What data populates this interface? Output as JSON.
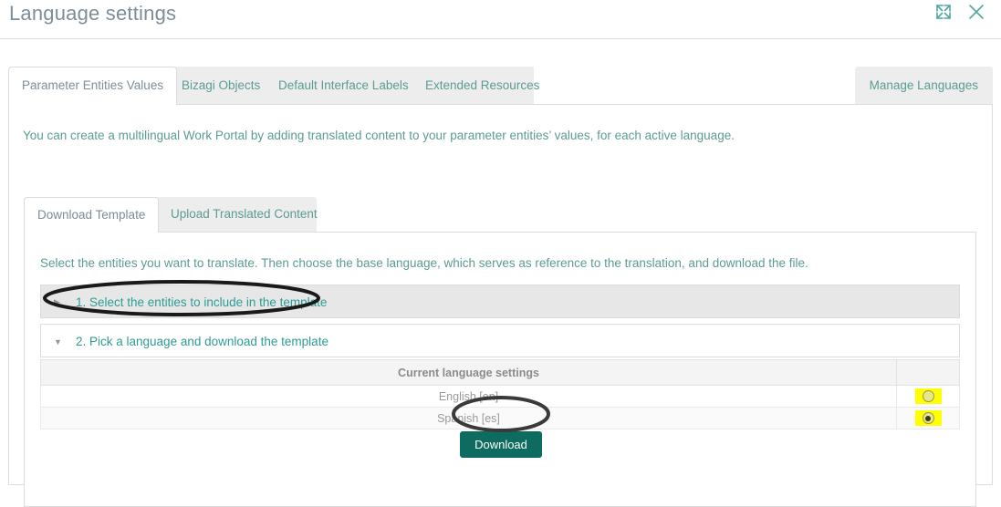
{
  "window": {
    "title": "Language settings",
    "expand_icon": "expand-icon",
    "close_icon": "close-icon"
  },
  "tabs": {
    "items": [
      {
        "label": "Parameter Entities Values",
        "active": true
      },
      {
        "label": "Bizagi Objects",
        "active": false
      },
      {
        "label": "Default Interface Labels",
        "active": false
      },
      {
        "label": "Extended Resources",
        "active": false
      }
    ],
    "manage_languages": "Manage Languages"
  },
  "body": {
    "intro": "You can create a multilingual Work Portal by adding translated content to your parameter entities’ values, for each active language."
  },
  "inner_tabs": {
    "items": [
      {
        "label": "Download Template",
        "active": true
      },
      {
        "label": "Upload Translated Content",
        "active": false
      }
    ]
  },
  "inner_panel": {
    "description": "Select the entities you want to translate. Then choose the base language, which serves as reference to the translation, and download the file.",
    "accordions": [
      {
        "label": "1. Select the entities to include in the template",
        "caret": "chevron-right-icon",
        "state": "collapsed"
      },
      {
        "label": "2. Pick a language and download the template",
        "caret": "chevron-down-icon",
        "state": "expanded"
      }
    ],
    "table": {
      "header": "Current language settings",
      "rows": [
        {
          "language": "English [en]",
          "selected": false
        },
        {
          "language": "Spanish [es]",
          "selected": true
        }
      ]
    },
    "download_button": "Download"
  },
  "colors": {
    "accent_teal": "#2e9c94",
    "button_green": "#0d6b5f",
    "highlight_yellow": "#ffff00",
    "annotation_black": "#1a1a1a",
    "text_gray": "#7d8d99"
  }
}
